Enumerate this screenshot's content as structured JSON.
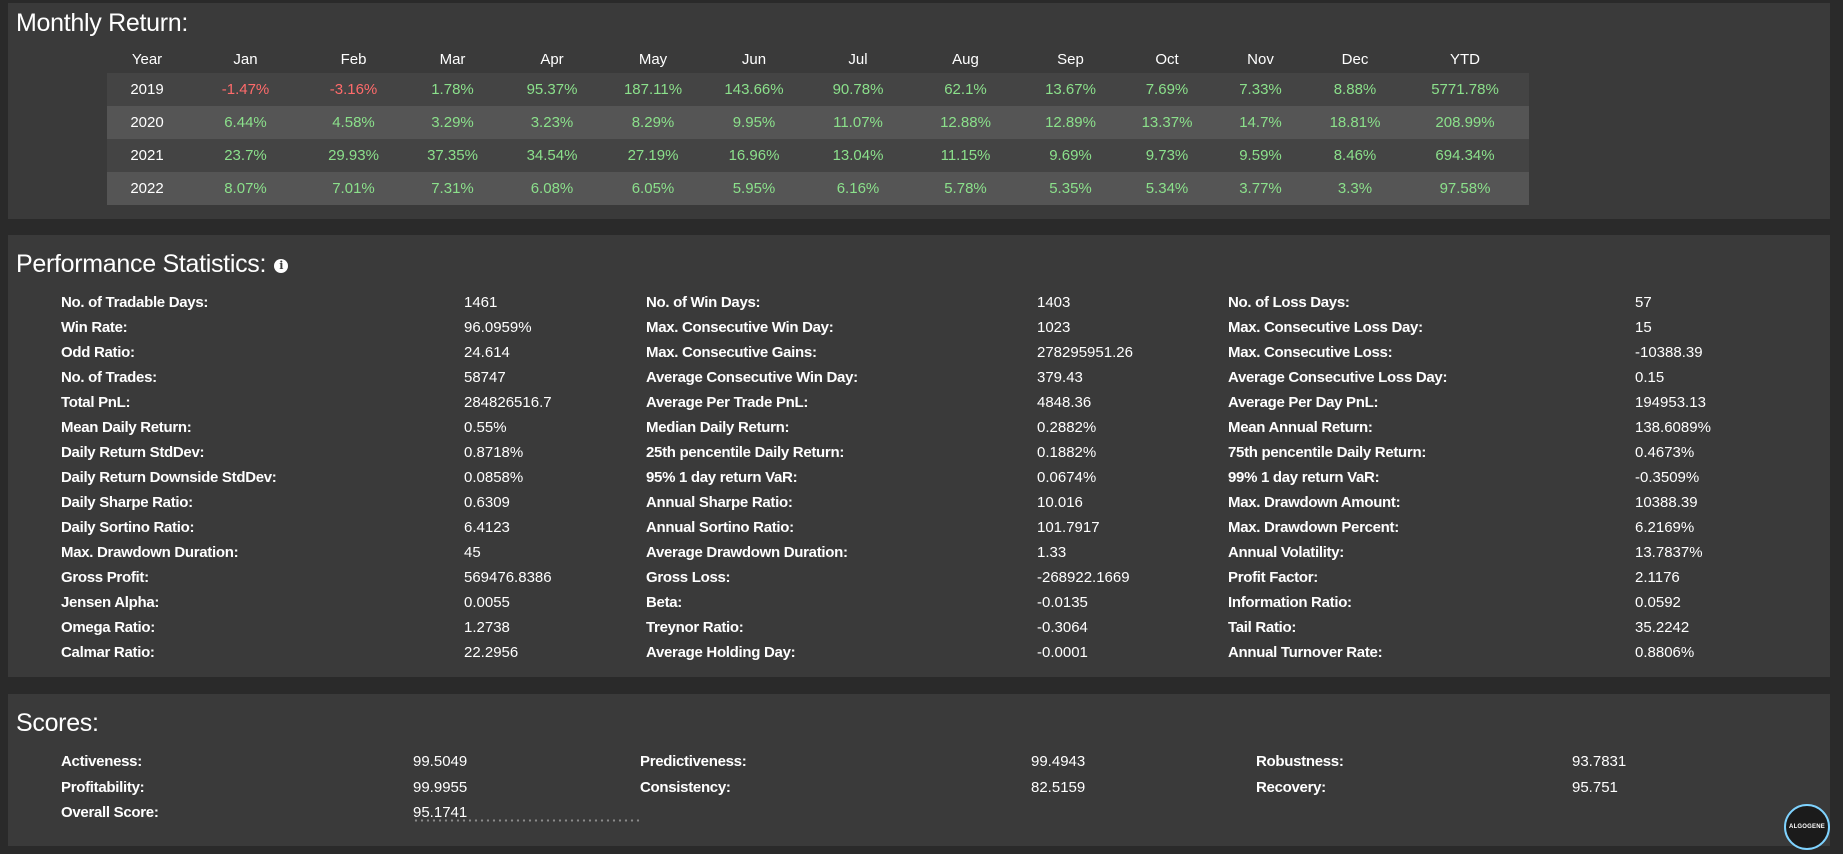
{
  "monthly": {
    "title": "Monthly Return:",
    "headers": [
      "Year",
      "Jan",
      "Feb",
      "Mar",
      "Apr",
      "May",
      "Jun",
      "Jul",
      "Aug",
      "Sep",
      "Oct",
      "Nov",
      "Dec",
      "YTD"
    ],
    "rows": [
      {
        "year": "2019",
        "values": [
          "-1.47%",
          "-3.16%",
          "1.78%",
          "95.37%",
          "187.11%",
          "143.66%",
          "90.78%",
          "62.1%",
          "13.67%",
          "7.69%",
          "7.33%",
          "8.88%",
          "5771.78%"
        ]
      },
      {
        "year": "2020",
        "values": [
          "6.44%",
          "4.58%",
          "3.29%",
          "3.23%",
          "8.29%",
          "9.95%",
          "11.07%",
          "12.88%",
          "12.89%",
          "13.37%",
          "14.7%",
          "18.81%",
          "208.99%"
        ]
      },
      {
        "year": "2021",
        "values": [
          "23.7%",
          "29.93%",
          "37.35%",
          "34.54%",
          "27.19%",
          "16.96%",
          "13.04%",
          "11.15%",
          "9.69%",
          "9.73%",
          "9.59%",
          "8.46%",
          "694.34%"
        ]
      },
      {
        "year": "2022",
        "values": [
          "8.07%",
          "7.01%",
          "7.31%",
          "6.08%",
          "6.05%",
          "5.95%",
          "6.16%",
          "5.78%",
          "5.35%",
          "5.34%",
          "3.77%",
          "3.3%",
          "97.58%"
        ]
      }
    ],
    "colors": {
      "positive": "#8be08b",
      "negative": "#ff6b6b"
    }
  },
  "performance": {
    "title": "Performance Statistics:",
    "info_icon": "info-icon",
    "columns": [
      [
        {
          "label": "No. of Tradable Days:",
          "value": "1461"
        },
        {
          "label": "Win Rate:",
          "value": "96.0959%"
        },
        {
          "label": "Odd Ratio:",
          "value": "24.614"
        },
        {
          "label": "No. of Trades:",
          "value": "58747"
        },
        {
          "label": "Total PnL:",
          "value": "284826516.7"
        },
        {
          "label": "Mean Daily Return:",
          "value": "0.55%"
        },
        {
          "label": "Daily Return StdDev:",
          "value": "0.8718%"
        },
        {
          "label": "Daily Return Downside StdDev:",
          "value": "0.0858%"
        },
        {
          "label": "Daily Sharpe Ratio:",
          "value": "0.6309"
        },
        {
          "label": "Daily Sortino Ratio:",
          "value": "6.4123"
        },
        {
          "label": "Max. Drawdown Duration:",
          "value": "45"
        },
        {
          "label": "Gross Profit:",
          "value": "569476.8386"
        },
        {
          "label": "Jensen Alpha:",
          "value": "0.0055"
        },
        {
          "label": "Omega Ratio:",
          "value": "1.2738"
        },
        {
          "label": "Calmar Ratio:",
          "value": "22.2956"
        }
      ],
      [
        {
          "label": "No. of Win Days:",
          "value": "1403"
        },
        {
          "label": "Max. Consecutive Win Day:",
          "value": "1023"
        },
        {
          "label": "Max. Consecutive Gains:",
          "value": "278295951.26"
        },
        {
          "label": "Average Consecutive Win Day:",
          "value": "379.43"
        },
        {
          "label": "Average Per Trade PnL:",
          "value": "4848.36"
        },
        {
          "label": "Median Daily Return:",
          "value": "0.2882%"
        },
        {
          "label": "25th pencentile Daily Return:",
          "value": "0.1882%"
        },
        {
          "label": "95% 1 day return VaR:",
          "value": "0.0674%"
        },
        {
          "label": "Annual Sharpe Ratio:",
          "value": "10.016"
        },
        {
          "label": "Annual Sortino Ratio:",
          "value": "101.7917"
        },
        {
          "label": "Average Drawdown Duration:",
          "value": "1.33"
        },
        {
          "label": "Gross Loss:",
          "value": "-268922.1669"
        },
        {
          "label": "Beta:",
          "value": "-0.0135"
        },
        {
          "label": "Treynor Ratio:",
          "value": "-0.3064"
        },
        {
          "label": "Average Holding Day:",
          "value": "-0.0001"
        }
      ],
      [
        {
          "label": "No. of Loss Days:",
          "value": "57"
        },
        {
          "label": "Max. Consecutive Loss Day:",
          "value": "15"
        },
        {
          "label": "Max. Consecutive Loss:",
          "value": "-10388.39"
        },
        {
          "label": "Average Consecutive Loss Day:",
          "value": "0.15"
        },
        {
          "label": "Average Per Day PnL:",
          "value": "194953.13"
        },
        {
          "label": "Mean Annual Return:",
          "value": "138.6089%"
        },
        {
          "label": "75th pencentile Daily Return:",
          "value": "0.4673%"
        },
        {
          "label": "99% 1 day return VaR:",
          "value": "-0.3509%"
        },
        {
          "label": "Max. Drawdown Amount:",
          "value": "10388.39"
        },
        {
          "label": "Max. Drawdown Percent:",
          "value": "6.2169%"
        },
        {
          "label": "Annual Volatility:",
          "value": "13.7837%"
        },
        {
          "label": "Profit Factor:",
          "value": "2.1176"
        },
        {
          "label": "Information Ratio:",
          "value": "0.0592"
        },
        {
          "label": "Tail Ratio:",
          "value": "35.2242"
        },
        {
          "label": "Annual Turnover Rate:",
          "value": "0.8806%"
        }
      ]
    ]
  },
  "scores": {
    "title": "Scores:",
    "columns": [
      [
        {
          "label": "Activeness:",
          "value": "99.5049"
        },
        {
          "label": "Profitability:",
          "value": "99.9955"
        },
        {
          "label": "Overall Score:",
          "value": "95.1741"
        }
      ],
      [
        {
          "label": "Predictiveness:",
          "value": "99.4943"
        },
        {
          "label": "Consistency:",
          "value": "82.5159"
        }
      ],
      [
        {
          "label": "Robustness:",
          "value": "93.7831"
        },
        {
          "label": "Recovery:",
          "value": "95.751"
        }
      ]
    ]
  },
  "logo": {
    "text": "ALGOGENE"
  }
}
